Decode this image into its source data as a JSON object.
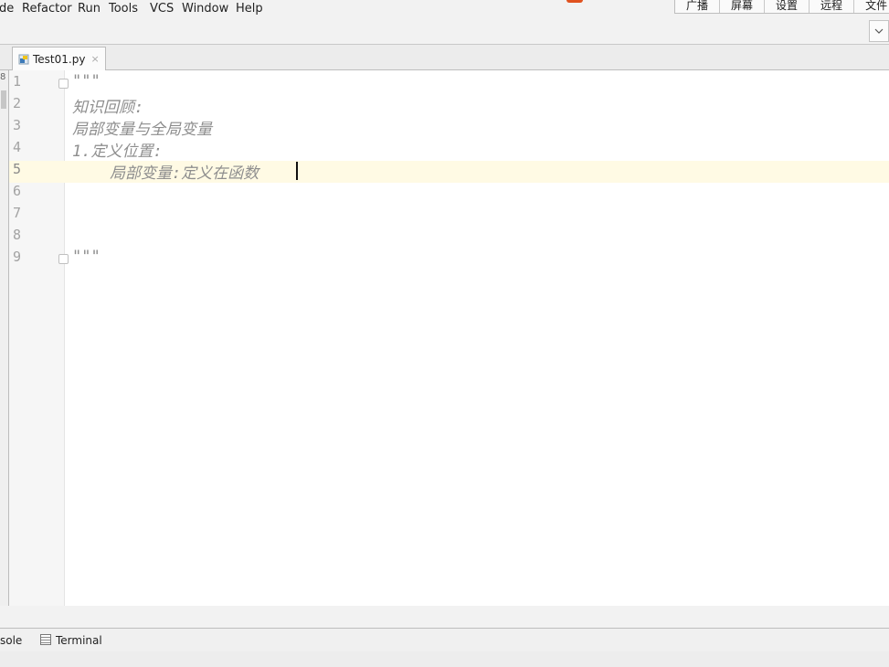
{
  "menubar": {
    "items": [
      {
        "label": "de"
      },
      {
        "label": "Refactor"
      },
      {
        "label": "Run"
      },
      {
        "label": "Tools"
      },
      {
        "label": "VCS"
      },
      {
        "label": "Window"
      },
      {
        "label": "Help"
      }
    ]
  },
  "overlay_toolbar": {
    "buttons": [
      "广播",
      "屏幕",
      "设置",
      "远程",
      "文件"
    ]
  },
  "tabs": [
    {
      "label": "Test01.py",
      "close": "×",
      "icon": "python-file-icon"
    }
  ],
  "left_strip": {
    "number": "8"
  },
  "editor": {
    "line_numbers": [
      "1",
      "2",
      "3",
      "4",
      "5",
      "6",
      "7",
      "8",
      "9"
    ],
    "lines": [
      "\"\"\"",
      "知识回顾:",
      "局部变量与全局变量",
      "1.定义位置:",
      "    局部变量:定义在函数",
      "",
      "",
      "",
      "\"\"\""
    ],
    "current_line": "5"
  },
  "tool_windows": [
    {
      "label": "sole"
    },
    {
      "label": "Terminal",
      "icon": "terminal-icon"
    }
  ],
  "colors": {
    "editor_bg": "#ffffff",
    "caret_row": "#fffae4",
    "docstring": "#8e8e8e",
    "line_number": "#a3a3a3",
    "accent": "#e0521f"
  }
}
